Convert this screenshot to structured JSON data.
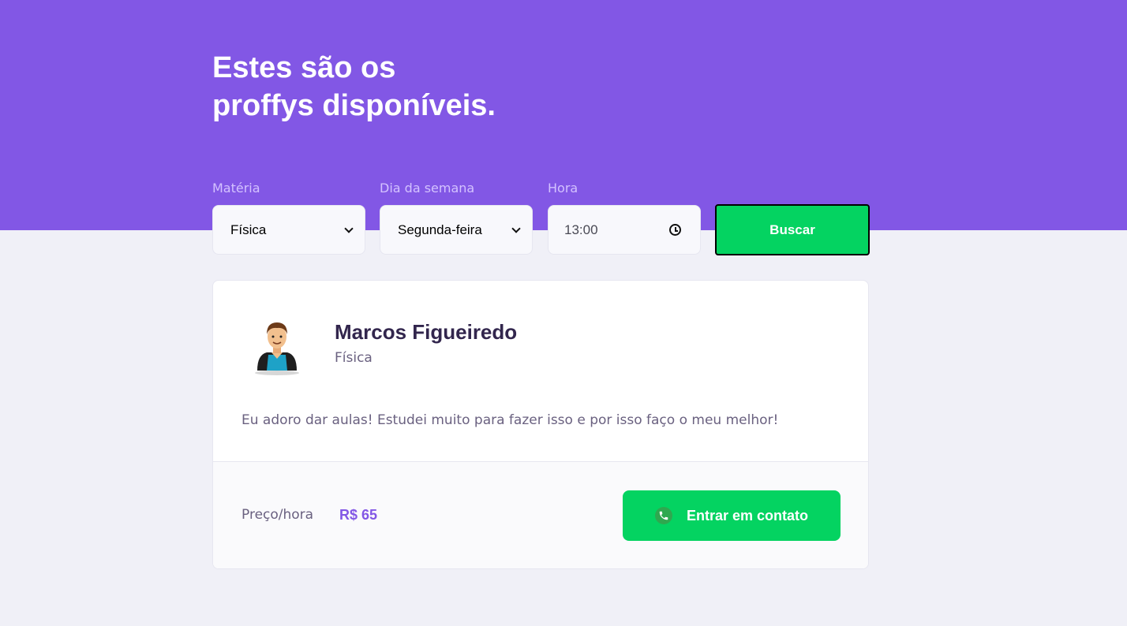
{
  "header": {
    "title_line1": "Estes são os",
    "title_line2": "proffys disponíveis."
  },
  "filters": {
    "subject": {
      "label": "Matéria",
      "value": "Física"
    },
    "weekday": {
      "label": "Dia da semana",
      "value": "Segunda-feira"
    },
    "time": {
      "label": "Hora",
      "value": "13:00"
    },
    "search_label": "Buscar"
  },
  "teacher": {
    "name": "Marcos Figueiredo",
    "subject": "Física",
    "bio": "Eu adoro dar aulas! Estudei muito para fazer isso e por isso faço o meu melhor!",
    "price_label": "Preço/hora",
    "price": "R$ 65",
    "contact_label": "Entrar em contato"
  },
  "colors": {
    "primary": "#8257e5",
    "secondary": "#04d361",
    "background": "#f0f0f7"
  }
}
